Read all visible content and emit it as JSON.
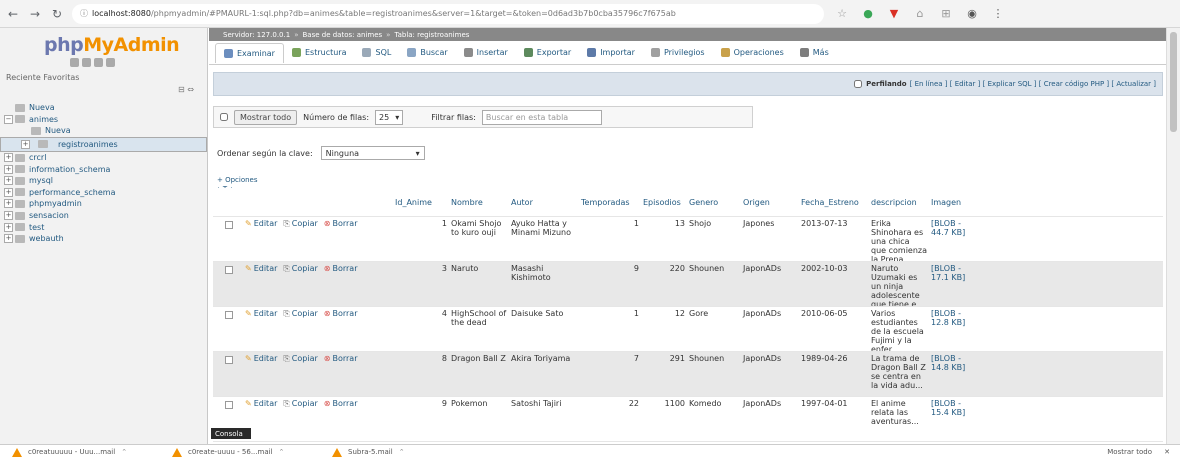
{
  "browser": {
    "url_host": "localhost:8080",
    "url_path": "/phpmyadmin/#PMAURL-1:sql.php?db=animes&table=registroanimes&server=1&target=&token=0d6ad3b7b0cba35796c7f675ab",
    "colors": {
      "bg": "#f3f3f3"
    }
  },
  "sidebar": {
    "logo_a": "php",
    "logo_b": "MyAdmin",
    "recent_label": "Reciente  Favoritas",
    "collapse": "⊟ ⇔",
    "tree": [
      {
        "label": "Nueva",
        "expander": "",
        "indent": 0,
        "selected": false
      },
      {
        "label": "animes",
        "expander": "−",
        "indent": 0,
        "selected": false
      },
      {
        "label": "Nueva",
        "expander": "",
        "indent": 1,
        "selected": false
      },
      {
        "label": "registroanimes",
        "expander": "+",
        "indent": 1,
        "selected": true
      },
      {
        "label": "crcrl",
        "expander": "+",
        "indent": 0,
        "selected": false
      },
      {
        "label": "information_schema",
        "expander": "+",
        "indent": 0,
        "selected": false
      },
      {
        "label": "mysql",
        "expander": "+",
        "indent": 0,
        "selected": false
      },
      {
        "label": "performance_schema",
        "expander": "+",
        "indent": 0,
        "selected": false
      },
      {
        "label": "phpmyadmin",
        "expander": "+",
        "indent": 0,
        "selected": false
      },
      {
        "label": "sensacion",
        "expander": "+",
        "indent": 0,
        "selected": false
      },
      {
        "label": "test",
        "expander": "+",
        "indent": 0,
        "selected": false
      },
      {
        "label": "webauth",
        "expander": "+",
        "indent": 0,
        "selected": false
      }
    ]
  },
  "breadcrumb": {
    "server": "Servidor: 127.0.0.1",
    "db": "Base de datos: animes",
    "table": "Tabla: registroanimes"
  },
  "tabs": [
    {
      "label": "Examinar",
      "active": true,
      "color": "#6c8ebf"
    },
    {
      "label": "Estructura",
      "active": false,
      "color": "#7aa35b"
    },
    {
      "label": "SQL",
      "active": false,
      "color": "#9aa9b8"
    },
    {
      "label": "Buscar",
      "active": false,
      "color": "#8aa5c4"
    },
    {
      "label": "Insertar",
      "active": false,
      "color": "#8b8b8b"
    },
    {
      "label": "Exportar",
      "active": false,
      "color": "#5d8a5d"
    },
    {
      "label": "Importar",
      "active": false,
      "color": "#5d7aa8"
    },
    {
      "label": "Privilegios",
      "active": false,
      "color": "#a0a0a0"
    },
    {
      "label": "Operaciones",
      "active": false,
      "color": "#c9a14a"
    },
    {
      "label": "Más",
      "active": false,
      "color": "#7d7d7d"
    }
  ],
  "infobar": {
    "label": "Perfilando",
    "links": "[ En línea ] [ Editar ] [ Explicar SQL ] [ Crear código PHP ] [ Actualizar ]"
  },
  "navform": {
    "show_all": "Mostrar todo",
    "rows_label": "Número de filas:",
    "rows_value": "25",
    "filter_label": "Filtrar filas:",
    "filter_placeholder": "Buscar en esta tabla"
  },
  "sort": {
    "label": "Ordenar según la clave:",
    "value": "Ninguna"
  },
  "options": {
    "label": "+ Opciones",
    "arrows": "←T→"
  },
  "table": {
    "columns": [
      "Id_Anime",
      "Nombre",
      "Autor",
      "Temporadas",
      "Episodios",
      "Genero",
      "Origen",
      "Fecha_Estreno",
      "descripcion",
      "Imagen"
    ],
    "actions": {
      "edit": "Editar",
      "copy": "Copiar",
      "delete": "Borrar"
    },
    "rows": [
      {
        "id": "1",
        "nombre": "Okami Shojo to kuro ouji",
        "autor": "Ayuko Hatta y Minami Mizuno",
        "temporadas": "1",
        "episodios": "13",
        "genero": "Shojo",
        "origen": "Japones",
        "fecha": "2013-07-13",
        "descripcion": "Erika Shinohara es una chica que comienza la Prepa...",
        "imagen": "[BLOB - 44.7 KB]"
      },
      {
        "id": "3",
        "nombre": "Naruto",
        "autor": "Masashi Kishimoto",
        "temporadas": "9",
        "episodios": "220",
        "genero": "Shounen",
        "origen": "JaponADs",
        "fecha": "2002-10-03",
        "descripcion": "Naruto Uzumaki es un ninja adolescente que tiene e...",
        "imagen": "[BLOB - 17.1 KB]"
      },
      {
        "id": "4",
        "nombre": "HighSchool of the dead",
        "autor": "Daisuke Sato",
        "temporadas": "1",
        "episodios": "12",
        "genero": "Gore",
        "origen": "JaponADs",
        "fecha": "2010-06-05",
        "descripcion": "Varios estudiantes de la escuela Fujimi y la enfer...",
        "imagen": "[BLOB - 12.8 KB]"
      },
      {
        "id": "8",
        "nombre": "Dragon Ball Z",
        "autor": "Akira Toriyama",
        "temporadas": "7",
        "episodios": "291",
        "genero": "Shounen",
        "origen": "JaponADs",
        "fecha": "1989-04-26",
        "descripcion": "La trama de Dragon Ball Z se centra en la vida adu...",
        "imagen": "[BLOB - 14.8 KB]"
      },
      {
        "id": "9",
        "nombre": "Pokemon",
        "autor": "Satoshi Tajiri",
        "temporadas": "22",
        "episodios": "1100",
        "genero": "Komedo",
        "origen": "JaponADs",
        "fecha": "1997-04-01",
        "descripcion": "El anime relata las aventuras...",
        "imagen": "[BLOB - 15.4 KB]"
      }
    ]
  },
  "console_label": "Consola",
  "downloads": [
    {
      "name": "c0reatuuuuu - Uuu...mail"
    },
    {
      "name": "c0reate-uuuu - 56...mail"
    },
    {
      "name": "Subra-5.mail"
    }
  ],
  "downloads_show_all": "Mostrar todo",
  "downloads_close": "✕"
}
